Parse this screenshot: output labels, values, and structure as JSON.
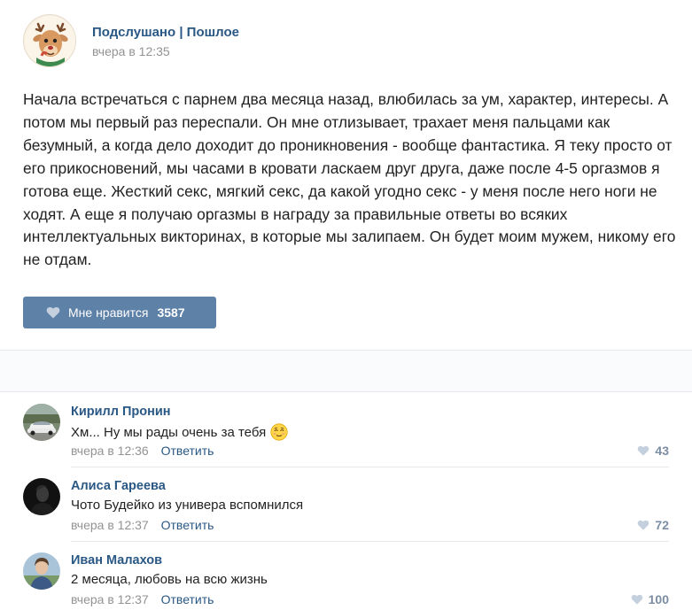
{
  "post": {
    "group_name": "Подслушано | Пошлое",
    "time": "вчера в 12:35",
    "text": "Начала встречаться с парнем два месяца назад, влюбилась за ум, характер, интересы. А потом мы первый раз переспали. Он мне отлизывает, трахает меня пальцами как безумный, а когда дело доходит до проникновения - вообще фантастика. Я теку просто от его прикосновений, мы часами в кровати ласкаем друг друга, даже после 4-5 оргазмов я готова еще. Жесткий секс, мягкий секс, да какой угодно секс - у меня после него ноги не ходят. А еще я получаю оргазмы в награду за правильные ответы во всяких интеллектуальных викторинах, в которые мы залипаем. Он будет моим мужем, никому его не отдам.",
    "like_label": "Мне нравится",
    "like_count": "3587"
  },
  "comments": [
    {
      "author": "Кирилл Пронин",
      "text": "Хм... Ну мы рады очень за тебя",
      "emoji": "relieved-face-emoji",
      "time": "вчера в 12:36",
      "reply_label": "Ответить",
      "likes": "43"
    },
    {
      "author": "Алиса Гареева",
      "text": "Чото Будейко из универа вспомнился",
      "time": "вчера в 12:37",
      "reply_label": "Ответить",
      "likes": "72"
    },
    {
      "author": "Иван Малахов",
      "text": "2 месяца, любовь на всю жизнь",
      "time": "вчера в 12:37",
      "reply_label": "Ответить",
      "likes": "100"
    }
  ],
  "colors": {
    "link": "#2a5885",
    "muted": "#939393",
    "like_button": "#5e81a8",
    "like_heart": "#c4d0dd"
  },
  "icons": {
    "heart": "heart-icon"
  }
}
